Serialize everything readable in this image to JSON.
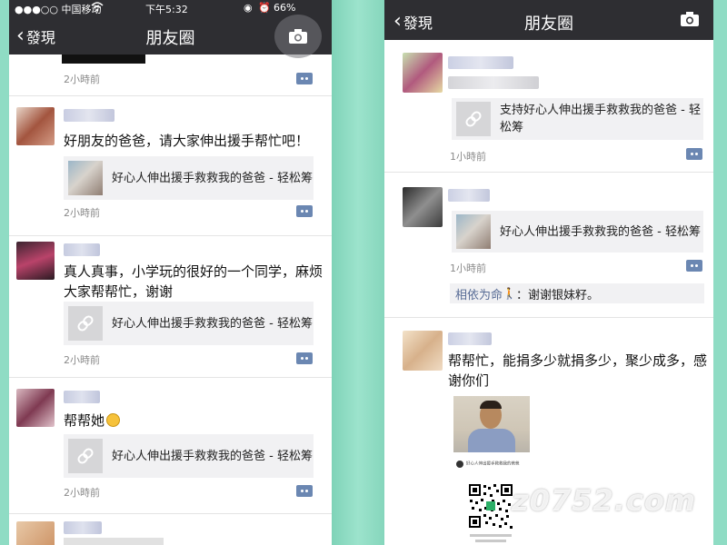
{
  "colors": {
    "background": "#8fdcc4",
    "nav_bar": "#2e2e32",
    "link_text": "#576b95",
    "card": "#f1f1f3",
    "comment_icon": "#6b87b2"
  },
  "left": {
    "status": {
      "carrier": "●●●○○ 中国移动",
      "wifi_icon": "wifi-icon",
      "time": "下午5:32",
      "battery": "66%"
    },
    "nav": {
      "back_label": "發現",
      "title": "朋友圈",
      "camera_icon": "camera-icon"
    },
    "posts": [
      {
        "time": "2小時前"
      },
      {
        "text": "好朋友的爸爸，请大家伸出援手帮忙吧！",
        "link": "好心人伸出援手救救我的爸爸 - 轻松筹",
        "thumb": "photo",
        "time": "2小時前"
      },
      {
        "text": "真人真事，小学玩的很好的一个同学，麻烦大家帮帮忙，谢谢",
        "link": "好心人伸出援手救救我的爸爸 - 轻松筹",
        "thumb": "link-icon",
        "time": "2小時前"
      },
      {
        "text": "帮帮她",
        "emoji": "smile-emoji",
        "link": "好心人伸出援手救救我的爸爸 - 轻松筹",
        "thumb": "link-icon",
        "time": "2小時前"
      }
    ]
  },
  "right": {
    "nav": {
      "back_label": "發現",
      "title": "朋友圈",
      "camera_icon": "camera-icon"
    },
    "posts": [
      {
        "link": "支持好心人伸出援手救救我的爸爸 - 轻松筹",
        "thumb": "link-icon",
        "time": "1小時前"
      },
      {
        "link": "好心人伸出援手救救我的爸爸 - 轻松筹",
        "thumb": "photo",
        "time": "1小時前",
        "comment": {
          "author": "相依为命",
          "text": "：谢谢银妹籽。"
        }
      },
      {
        "text": "帮帮忙，能捐多少就捐多少，聚少成多，感谢你们",
        "images": [
          "person-photo",
          "qr-code"
        ],
        "qr_caption": "好心人伸出援手救救我的爸爸"
      }
    ],
    "watermark": "z0752.com"
  }
}
